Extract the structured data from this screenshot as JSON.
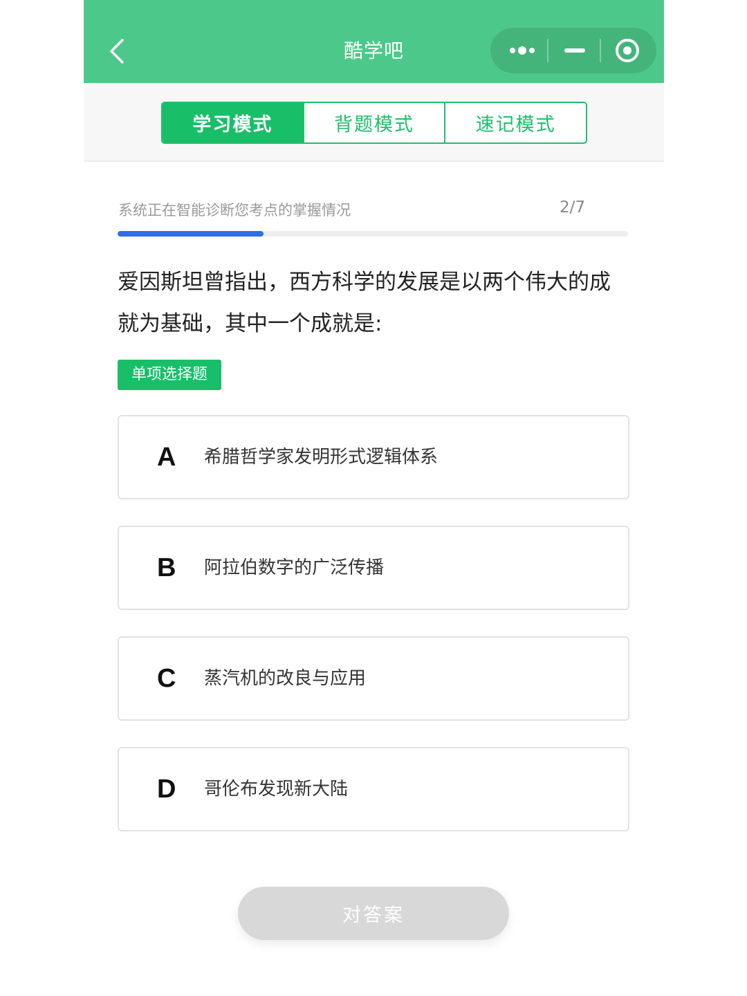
{
  "header": {
    "title": "酷学吧",
    "back_icon": "chevron-left-icon",
    "menu_icons": [
      "more-dots-icon",
      "minimize-icon",
      "close-target-icon"
    ]
  },
  "modes": [
    {
      "label": "学习模式",
      "active": true
    },
    {
      "label": "背题模式",
      "active": false
    },
    {
      "label": "速记模式",
      "active": false
    }
  ],
  "progress": {
    "text": "系统正在智能诊断您考点的掌握情况",
    "count": "2/7",
    "fraction": 0.2857
  },
  "question": {
    "text": "爱因斯坦曾指出，西方科学的发展是以两个伟大的成就为基础，其中一个成就是:",
    "type": "单项选择题"
  },
  "options": [
    {
      "letter": "A",
      "text": "希腊哲学家发明形式逻辑体系"
    },
    {
      "letter": "B",
      "text": "阿拉伯数字的广泛传播"
    },
    {
      "letter": "C",
      "text": "蒸汽机的改良与应用"
    },
    {
      "letter": "D",
      "text": "哥伦布发现新大陆"
    }
  ],
  "submit_label": "对答案",
  "colors": {
    "header": "#4cc98a",
    "accent": "#18bf68",
    "progress": "#2f6fe8",
    "disabled_button": "#d8d8d8"
  }
}
